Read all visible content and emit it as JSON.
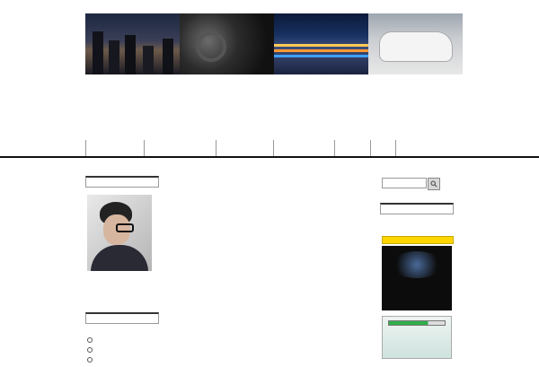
{
  "header": {
    "top_link": "",
    "title_line1": "",
    "title_line2": "",
    "tagline": ""
  },
  "nav": {
    "items": [
      {
        "label": ""
      },
      {
        "label": ""
      },
      {
        "label": ""
      },
      {
        "label": ""
      },
      {
        "label": ""
      },
      {
        "label": ""
      }
    ]
  },
  "left_sidebar": {
    "profile_heading": "",
    "profile_name": "",
    "profile_description": "",
    "category_heading": "",
    "categories": [
      "",
      "",
      ""
    ]
  },
  "main": {
    "heading_lines": [
      "",
      ""
    ],
    "red_lines": [
      "",
      ""
    ],
    "entries": [
      {
        "label": "",
        "link": ""
      },
      {
        "label": "",
        "link": ""
      },
      {
        "label": "",
        "link": ""
      }
    ],
    "footer_lines": [
      "",
      ""
    ]
  },
  "right_sidebar": {
    "search_placeholder": "",
    "search_button_icon": "search-icon",
    "widget_heading": "",
    "promo_text": "",
    "banner_caption": "",
    "banner_text": "",
    "banner_headline": "",
    "loading_text": ""
  },
  "colors": {
    "link": "#1a5fb4",
    "red_text": "#cc0000",
    "title": "#1a1a55",
    "banner_yellow": "#ffd600"
  }
}
